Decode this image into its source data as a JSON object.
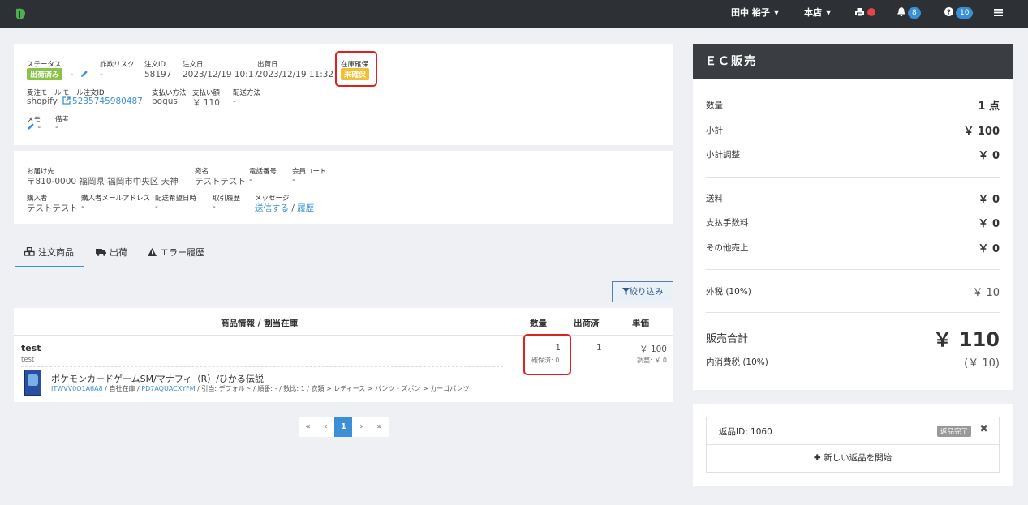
{
  "topbar": {
    "user": "田中 裕子",
    "store": "本店",
    "notifications_count": "8",
    "help_count": "10"
  },
  "order": {
    "status_label": "ステータス",
    "status_value": "出荷済み",
    "status_dash": "-",
    "fraud_label": "詐欺リスク",
    "fraud_value": "-",
    "order_id_label": "注文ID",
    "order_id_value": "58197",
    "order_date_label": "注文日",
    "order_date_value": "2023/12/19 10:17",
    "ship_date_label": "出荷日",
    "ship_date_value": "2023/12/19 11:32",
    "stock_label": "在庫確保",
    "stock_value": "未確保",
    "mall_label": "受注モール",
    "mall_value": "shopify",
    "mall_order_id_label": "モール注文ID",
    "mall_order_id_value": "5235745980487",
    "payment_method_label": "支払い方法",
    "payment_method_value": "bogus",
    "payment_amount_label": "支払い額",
    "payment_amount_value": "￥ 110",
    "delivery_method_label": "配送方法",
    "delivery_method_value": "-",
    "memo_label": "メモ",
    "memo_value": "-",
    "note_label": "備考",
    "note_value": "-"
  },
  "shipping": {
    "address_label": "お届け先",
    "address_value": "〒810-0000 福岡県 福岡市中央区 天神",
    "recipient_label": "宛名",
    "recipient_value": "テストテスト",
    "phone_label": "電話番号",
    "phone_value": "-",
    "member_label": "会員コード",
    "member_value": "-",
    "buyer_label": "購入者",
    "buyer_value": "テストテスト",
    "buyer_email_label": "購入者メールアドレス",
    "buyer_email_value": "-",
    "delivery_date_label": "配送希望日時",
    "delivery_date_value": "-",
    "history_label": "取引履歴",
    "history_value": "-",
    "message_label": "メッセージ",
    "message_send": "送信する",
    "message_sep": "/",
    "message_history": "履歴"
  },
  "tabs": [
    {
      "label": "注文商品"
    },
    {
      "label": "出荷"
    },
    {
      "label": "エラー履歴"
    }
  ],
  "filter_button": "絞り込み",
  "table": {
    "headers": [
      "商品情報 / 割当在庫",
      "数量",
      "出荷済",
      "単価"
    ],
    "item_name": "test",
    "item_sku": "test",
    "quantity": "1",
    "reserved": "確保済: 0",
    "shipped": "1",
    "unit_price": "￥ 100",
    "adjustment": "調整: ￥ 0",
    "stock_item_name": "ポケモンカードゲームSM/マナフィ（R）/ひかる伝説",
    "stock_code": "ITWVV0O1A6A8",
    "stock_sep1": " / 自社在庫 / ",
    "stock_location_code": "PD7AQUACXYFM",
    "stock_detail": " / 引当: デフォルト / 順番: - / 数比: 1 / 衣類 > レディース > パンツ・ズボン > カーゴパンツ"
  },
  "pagination": [
    "«",
    "‹",
    "1",
    "›",
    "»"
  ],
  "summary": {
    "title": "ＥＣ販売",
    "rows1": [
      {
        "label": "数量",
        "value": "1 点"
      },
      {
        "label": "小計",
        "value": "￥ 100"
      },
      {
        "label": "小計調整",
        "value": "￥ 0"
      }
    ],
    "rows2": [
      {
        "label": "送料",
        "value": "￥ 0"
      },
      {
        "label": "支払手数料",
        "value": "￥ 0"
      },
      {
        "label": "その他売上",
        "value": "￥ 0"
      }
    ],
    "tax_label": "外税 (10%)",
    "tax_value": "￥ 10",
    "total_label": "販売合計",
    "total_value": "￥ 110",
    "inner_tax_label": "内消費税 (10%)",
    "inner_tax_value": "(￥ 10)"
  },
  "returns": {
    "return_id": "返品ID: 1060",
    "return_status": "返品完了",
    "new_return": "新しい返品を開始"
  },
  "colors": {
    "topbar": "#2d3035",
    "accent": "#3b8fd6",
    "status_green": "#8bc34a",
    "status_yellow": "#f0c030",
    "highlight_red": "#e02020"
  }
}
